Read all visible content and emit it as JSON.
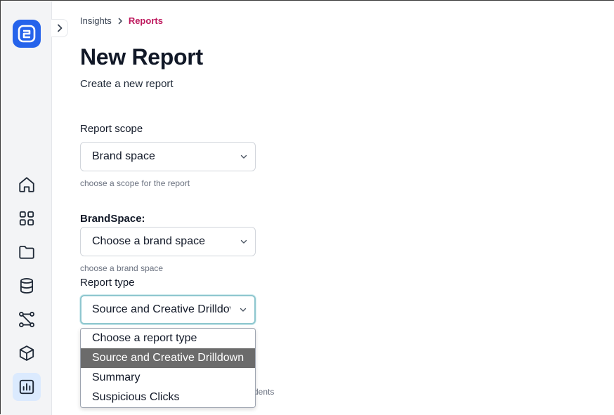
{
  "breadcrumb": {
    "parent": "Insights",
    "current": "Reports"
  },
  "page": {
    "title": "New Report",
    "subtitle": "Create a new report"
  },
  "form": {
    "report_scope": {
      "label": "Report scope",
      "value": "Brand space",
      "helper": "choose a scope for the report"
    },
    "brandspace": {
      "label": "BrandSpace:",
      "value": "Choose a brand space",
      "helper": "choose a brand space"
    },
    "report_type": {
      "label": "Report type",
      "value": "Source and Creative Drilldown",
      "options": [
        "Choose a report type",
        "Source and Creative Drilldown",
        "Summary",
        "Suspicious Clicks"
      ],
      "highlighted_option": "Source and Creative Drilldown"
    },
    "obscured_helper_fragment": "dents"
  },
  "sidebar": {
    "items": [
      "home-icon",
      "grid-icon",
      "folder-icon",
      "database-icon",
      "workflow-icon",
      "cube-icon",
      "bar-chart-icon"
    ],
    "active": "bar-chart-icon"
  },
  "colors": {
    "brand": "#2563eb",
    "active_nav_bg": "#dbeafe",
    "breadcrumb_current": "#be185d",
    "focus_ring": "#8fc7cf",
    "highlight_option_bg": "#6b6b6b"
  }
}
